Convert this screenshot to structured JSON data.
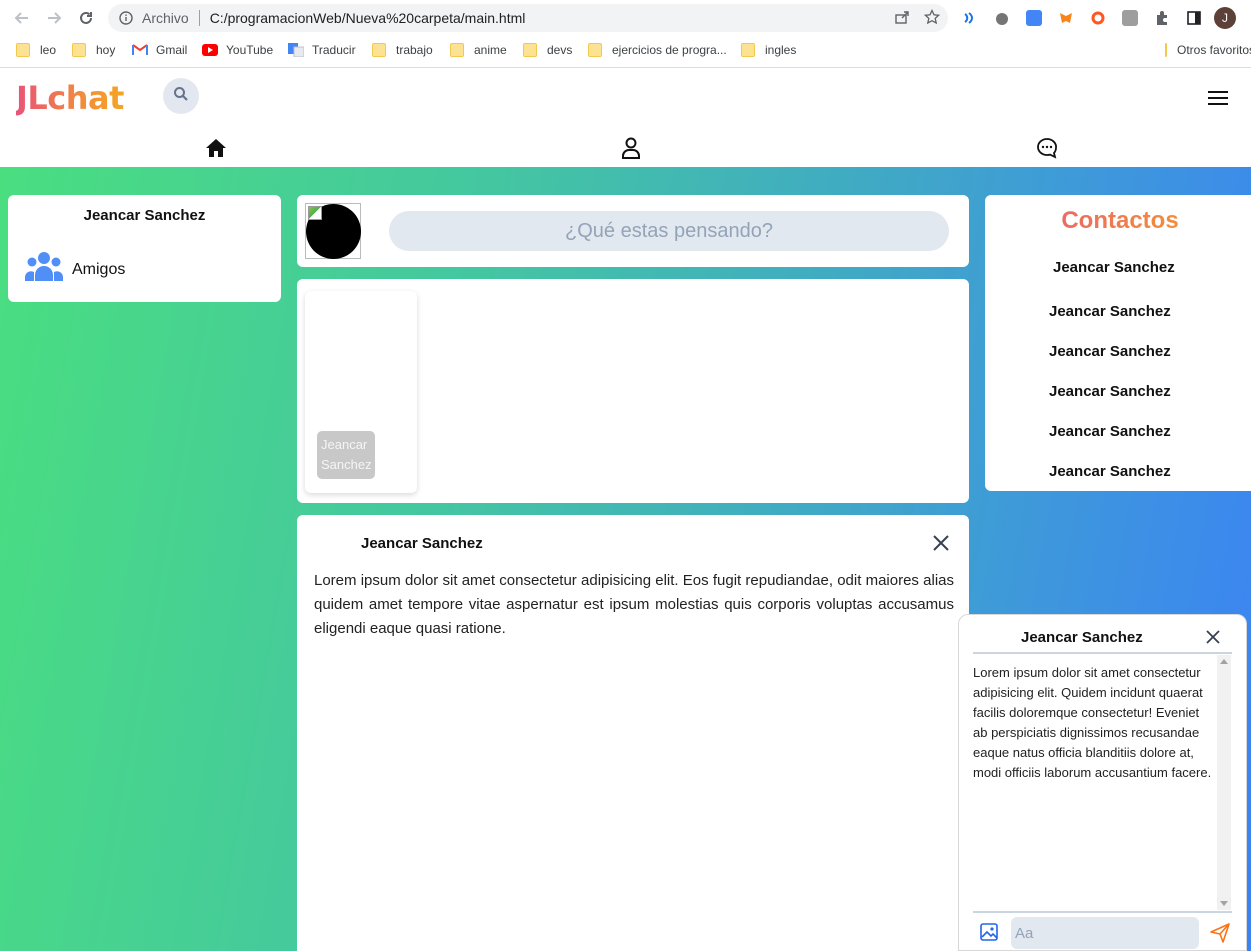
{
  "browser": {
    "security_label": "Archivo",
    "url": "C:/programacionWeb/Nueva%20carpeta/main.html",
    "profile_initial": "J",
    "bookmarks": [
      {
        "label": "leo",
        "icon": "folder-icon"
      },
      {
        "label": "hoy",
        "icon": "folder-icon"
      },
      {
        "label": "Gmail",
        "icon": "gmail-icon"
      },
      {
        "label": "YouTube",
        "icon": "youtube-icon"
      },
      {
        "label": "Traducir",
        "icon": "translate-icon"
      },
      {
        "label": "trabajo",
        "icon": "folder-icon"
      },
      {
        "label": "anime",
        "icon": "folder-icon"
      },
      {
        "label": "devs",
        "icon": "folder-icon"
      },
      {
        "label": "ejercicios de progra...",
        "icon": "folder-icon"
      },
      {
        "label": "ingles",
        "icon": "folder-icon"
      },
      {
        "label": "Otros favoritos",
        "icon": "folder-icon"
      }
    ]
  },
  "app": {
    "logo": "JLchat",
    "nav": [
      "home-icon",
      "user-icon",
      "chat-bubble-icon"
    ]
  },
  "sidebar": {
    "user_name": "Jeancar Sanchez",
    "friends_label": "Amigos"
  },
  "composer": {
    "placeholder": "¿Qué estas pensando?"
  },
  "stories": [
    {
      "name": "Jeancar Sanchez"
    }
  ],
  "post": {
    "author": "Jeancar Sanchez",
    "text": "Lorem ipsum dolor sit amet consectetur adipisicing elit. Eos fugit repudiandae, odit maiores alias quidem amet tempore vitae aspernatur est ipsum molestias quis corporis voluptas accusamus eligendi eaque quasi ratione."
  },
  "contacts": {
    "title": "Contactos",
    "items": [
      "Jeancar Sanchez",
      "Jeancar Sanchez",
      "Jeancar Sanchez",
      "Jeancar Sanchez",
      "Jeancar Sanchez",
      "Jeancar Sanchez"
    ]
  },
  "chat": {
    "name": "Jeancar Sanchez",
    "message": "Lorem ipsum dolor sit amet consectetur adipisicing elit. Quidem incidunt quaerat facilis doloremque consectetur! Eveniet ab perspiciatis dignissimos recusandae eaque natus officia blanditiis dolore at, modi officiis laborum accusantium facere.",
    "input_placeholder": "Aa"
  },
  "colors": {
    "gradient_start": "#4ade80",
    "gradient_end": "#3b82f6",
    "logo_start": "#e8537a",
    "logo_end": "#f5a623"
  }
}
